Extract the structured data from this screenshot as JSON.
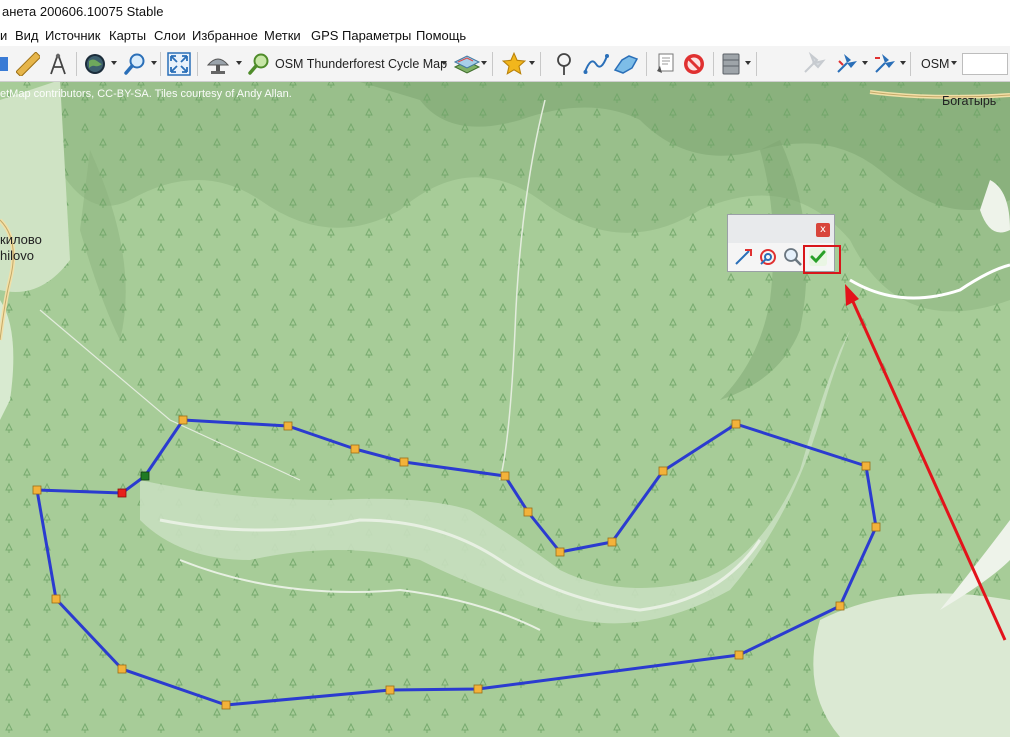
{
  "window": {
    "title": "анета 200606.10075 Stable"
  },
  "menu": {
    "items": [
      {
        "label": "и"
      },
      {
        "label": "Вид"
      },
      {
        "label": "Источник"
      },
      {
        "label": "Карты"
      },
      {
        "label": "Слои"
      },
      {
        "label": "Избранное"
      },
      {
        "label": "Метки"
      },
      {
        "label": "GPS"
      },
      {
        "label": "Параметры"
      },
      {
        "label": "Помощь"
      }
    ]
  },
  "toolbar": {
    "map_source_label": "OSM Thunderforest Cycle Map",
    "source_short_label": "OSM",
    "search_value": "",
    "icons": [
      "ruler-icon",
      "compass-icon",
      "globe-icon",
      "zoom-icon",
      "fullscreen-icon",
      "satellite-icon",
      "map-search-icon",
      "layers-icon",
      "star-icon",
      "marker-icon",
      "path-icon",
      "polygon-icon",
      "notes-icon",
      "no-entry-icon",
      "database-icon",
      "gps-icon"
    ]
  },
  "map": {
    "attribution": "etMap contributors, CC-BY-SA. Tiles courtesy of Andy Allan.",
    "place_labels": {
      "left_top": "килово",
      "left_bottom": "hilovo",
      "right": "Богатырь"
    },
    "colors": {
      "route": "#2b3bd0",
      "vertex": "#f3b23a",
      "start": "#e8201c",
      "end": "#1f7a23",
      "arrow": "#e3131b"
    }
  },
  "polygon_edit_popup": {
    "close_label": "x",
    "tools": [
      "edit-path-icon",
      "target-icon",
      "zoom-icon",
      "apply-check-icon"
    ]
  }
}
